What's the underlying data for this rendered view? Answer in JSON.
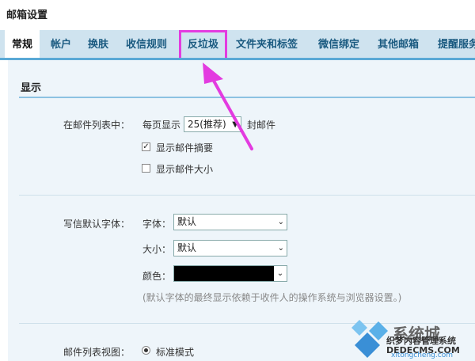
{
  "page_title": "邮箱设置",
  "tabs": [
    {
      "label": "常规"
    },
    {
      "label": "帐户"
    },
    {
      "label": "换肤"
    },
    {
      "label": "收信规则"
    },
    {
      "label": "反垃圾"
    },
    {
      "label": "文件夹和标签"
    },
    {
      "label": "微信绑定"
    },
    {
      "label": "其他邮箱"
    },
    {
      "label": "提醒服务"
    }
  ],
  "display": {
    "section_title": "显示",
    "in_list_label": "在邮件列表中：",
    "per_page_label": "每页显示",
    "per_page_value": "25(推荐)",
    "per_page_suffix": "封邮件",
    "show_summary_label": "显示邮件摘要",
    "show_summary_checked": true,
    "show_size_label": "显示邮件大小",
    "show_size_checked": false
  },
  "font": {
    "label": "写信默认字体：",
    "family_label": "字体：",
    "family_value": "默认",
    "size_label": "大小：",
    "size_value": "默认",
    "color_label": "颜色：",
    "color_value": "#000000",
    "hint": "(默认字体的最终显示依赖于收件人的操作系统与浏览器设置。)"
  },
  "list_view": {
    "label": "邮件列表视图：",
    "option_label": "标准模式"
  },
  "watermark": {
    "line1": "系统城",
    "line2": "织梦内容管理系统",
    "line3": "DEDECMS.COM",
    "line4": "xitongcheng.com"
  },
  "colors": {
    "tab_bar": "#cfe3ef",
    "tab_border": "#5aa9d6",
    "highlight": "#e33be0",
    "content_bg": "#eef5fa"
  }
}
